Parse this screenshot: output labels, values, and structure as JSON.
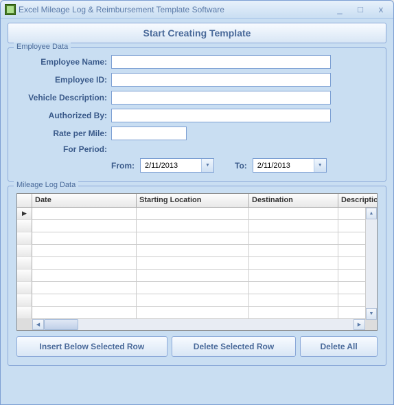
{
  "window": {
    "title": "Excel Mileage Log & Reimbursement Template Software"
  },
  "buttons": {
    "start": "Start Creating Template",
    "insert": "Insert Below Selected Row",
    "delete_row": "Delete Selected Row",
    "delete_all": "Delete All"
  },
  "employee": {
    "legend": "Employee Data",
    "labels": {
      "name": "Employee Name:",
      "id": "Employee ID:",
      "vehicle": "Vehicle Description:",
      "authorized": "Authorized By:",
      "rate": "Rate per Mile:",
      "period": "For Period:",
      "from": "From:",
      "to": "To:"
    },
    "values": {
      "name": "",
      "id": "",
      "vehicle": "",
      "authorized": "",
      "rate": "",
      "from_date": "2/11/2013",
      "to_date": "2/11/2013"
    }
  },
  "mileage": {
    "legend": "Mileage Log Data",
    "columns": {
      "date": "Date",
      "starting": "Starting Location",
      "destination": "Destination",
      "description": "Descriptio"
    },
    "rows": []
  }
}
